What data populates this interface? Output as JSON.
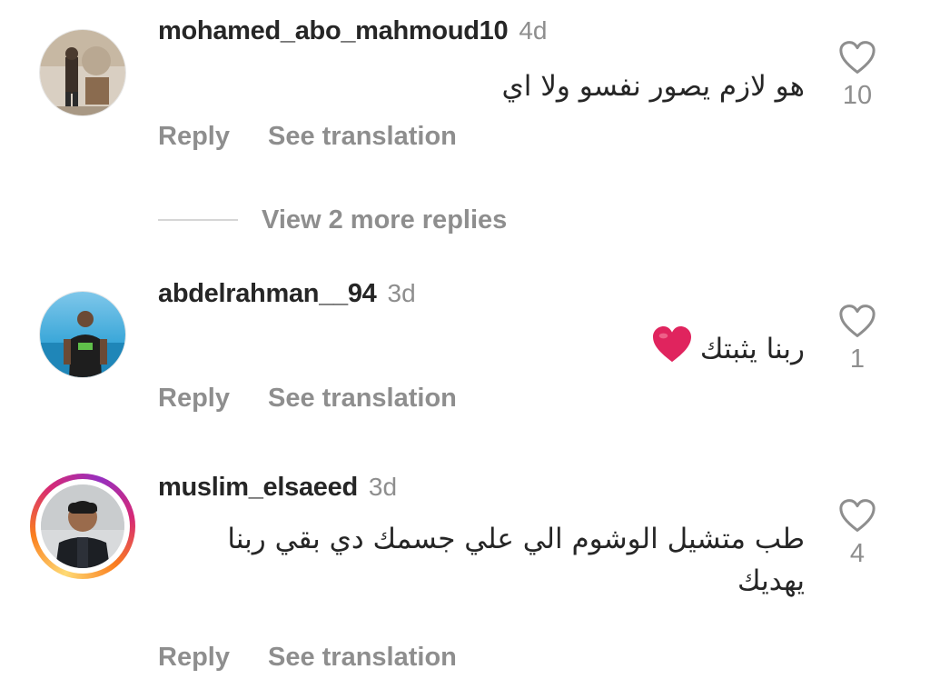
{
  "comments": [
    {
      "username": "mohamed_abo_mahmoud10",
      "time": "4d",
      "text": "هو لازم يصور نفسو ولا اي",
      "likes": "10",
      "reply_label": "Reply",
      "translate_label": "See translation"
    },
    {
      "username": "abdelrahman__94",
      "time": "3d",
      "text": "ربنا يثبتك",
      "emoji": "red-heart",
      "likes": "1",
      "reply_label": "Reply",
      "translate_label": "See translation"
    },
    {
      "username": "muslim_elsaeed",
      "time": "3d",
      "text": "طب متشيل الوشوم الي علي جسمك دي بقي ربنا يهديك",
      "likes": "4",
      "has_story_ring": true,
      "reply_label": "Reply",
      "translate_label": "See translation"
    }
  ],
  "view_more_replies": "View 2 more replies",
  "icons": {
    "like": "heart-outline-icon"
  },
  "colors": {
    "text": "#262626",
    "secondary": "#8e8e8e",
    "emoji_heart": "#e0245e"
  }
}
